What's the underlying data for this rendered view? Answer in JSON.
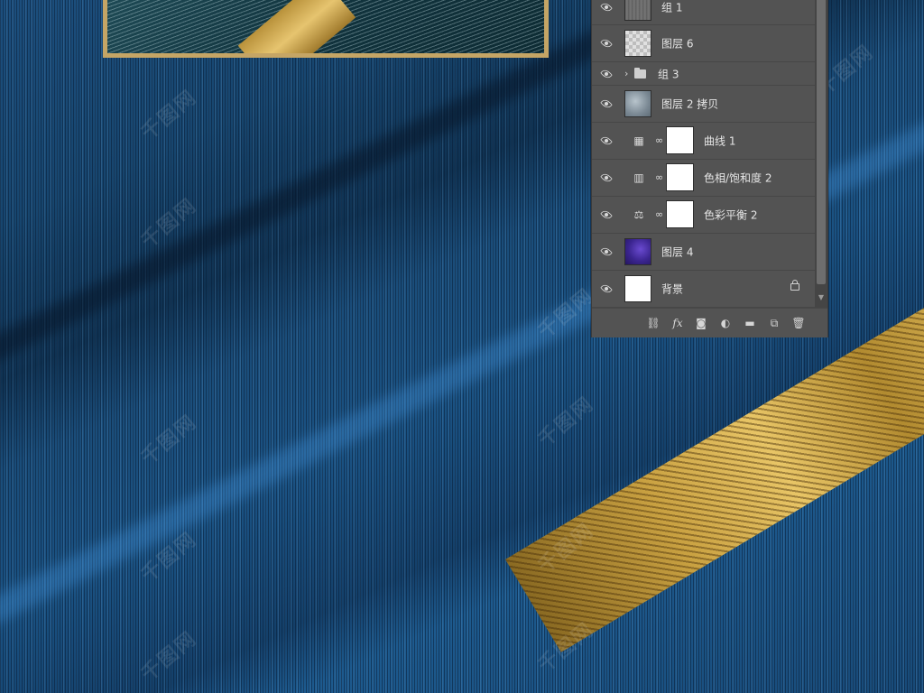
{
  "canvas": {
    "watermark_text": "千图网"
  },
  "layers_panel": {
    "layers": [
      {
        "name": "组 1",
        "kind": "pixel",
        "thumb": "wood-texture",
        "visible": true
      },
      {
        "name": "图层 6",
        "kind": "pixel",
        "thumb": "transparent-checker",
        "visible": true
      },
      {
        "name": "组 3",
        "kind": "group",
        "visible": true
      },
      {
        "name": "图层 2 拷贝",
        "kind": "pixel",
        "thumb": "stone-texture",
        "visible": true
      },
      {
        "name": "曲线 1",
        "kind": "adjustment",
        "icon": "curves-icon",
        "icon_glyph": "▦",
        "visible": true
      },
      {
        "name": "色相/饱和度 2",
        "kind": "adjustment",
        "icon": "hue-saturation-icon",
        "icon_glyph": "▥",
        "visible": true
      },
      {
        "name": "色彩平衡 2",
        "kind": "adjustment",
        "icon": "color-balance-icon",
        "icon_glyph": "⚖",
        "visible": true
      },
      {
        "name": "图层 4",
        "kind": "pixel",
        "thumb": "purple-texture",
        "visible": true
      },
      {
        "name": "背景",
        "kind": "background",
        "thumb": "white",
        "locked": true,
        "visible": true
      }
    ],
    "footer_buttons": [
      {
        "name": "link-layers-icon",
        "glyph": "⛓"
      },
      {
        "name": "fx-icon",
        "glyph": "fx"
      },
      {
        "name": "add-mask-icon",
        "glyph": "◙"
      },
      {
        "name": "adjustment-layer-icon",
        "glyph": "◐"
      },
      {
        "name": "new-group-icon",
        "glyph": "▬"
      },
      {
        "name": "new-layer-icon",
        "glyph": "⧉"
      },
      {
        "name": "delete-layer-icon",
        "glyph": "🗑"
      }
    ]
  },
  "colors": {
    "panel_bg": "#535353",
    "canvas_blue": "#1a4d7a",
    "gold": "#c9a141"
  }
}
